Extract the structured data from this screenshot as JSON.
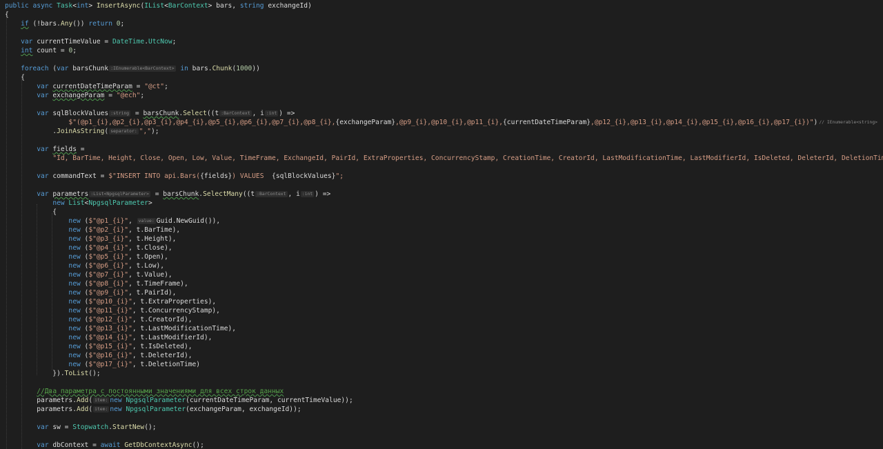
{
  "editor": {
    "t": {
      "public": "public",
      "async": "async",
      "Task": "Task",
      "int": "int",
      "InsertAsync": "InsertAsync",
      "IList": "IList",
      "BarContext": "BarContext",
      "bars": "bars",
      "string": "string",
      "exchangeId": "exchangeId",
      "if": "if",
      "Any": "Any",
      "return": "return",
      "zero": "0",
      "var": "var",
      "currentTimeValue": "currentTimeValue",
      "DateTime": "DateTime",
      "UtcNow": "UtcNow",
      "count": "count",
      "foreach": "foreach",
      "barsChunk": "barsChunk",
      "in": "in",
      "Chunk": "Chunk",
      "thousand": "1000",
      "currentDateTimeParam": "currentDateTimeParam",
      "exchangeParam": "exchangeParam",
      "ctString": "\"@ct\"",
      "echString": "\"@ech\"",
      "sqlBlockValues": "sqlBlockValues",
      "Select": "Select",
      "tParam": "t",
      "iParam": "i",
      "JoinAsString": "JoinAsString",
      "commaString": "\",\"",
      "fields": "fields",
      "commandText": "commandText",
      "parametrs": "parametrs",
      "SelectMany": "SelectMany",
      "new": "new",
      "List": "List",
      "NpgsqlParameter": "NpgsqlParameter",
      "Guid": "Guid",
      "NewGuid": "NewGuid",
      "ToList": "ToList",
      "Add": "Add",
      "sw": "sw",
      "Stopwatch": "Stopwatch",
      "StartNew": "StartNew",
      "dbContext": "dbContext",
      "await": "await",
      "GetDbContextAsync": "GetDbContextAsync",
      "fieldsString": "\"Id, BarTime, Height, Close, Open, Low, Value, TimeFrame, ExchangeId, PairId, ExtraProperties, ConcurrencyStamp, CreationTime, CreatorId, LastModificationTime, LastModifierId, IsDeleted, DeleterId, DeletionTime\";",
      "sqlDollar": "$\"(",
      "sqlPart1": "@p1_{i},@p2_{i},@p3_{i},@p4_{i},@p5_{i},@p6_{i},@p7_{i},@p8_{i},",
      "sqlPart2": "{exchangeParam}",
      "sqlPart3": ",@p9_{i},@p10_{i},@p11_{i},",
      "sqlPart4": "{currentDateTimeParam}",
      "sqlPart5": ",@p12_{i},@p13_{i},@p14_{i},@p15_{i},@p16_{i},@p17_{i})\"",
      "insertPart1": "$\"INSERT INTO api.Bars(",
      "insertPart2": "{fields}",
      "insertPart3": ") VALUES  ",
      "insertPart4": "{sqlBlockValues}",
      "insertPart5": "\";",
      "comment": "//Два параметра с постоянными значениями для всех строк данных"
    },
    "hints": {
      "IEnumerableBarContext": ":IEnumerable<BarContext>",
      "string": ":string",
      "BarContext": ":BarContext",
      "int": ":int",
      "IEnumerableString": "// IEnumerable<string>",
      "separator": "separator:",
      "ListNpgsql": ":List<NpgsqlParameter>",
      "value": "value:",
      "item": "item:"
    },
    "params": [
      {
        "name": "$\"@p1_{i}\"",
        "value": "Guid.NewGuid()),"
      },
      {
        "name": "$\"@p2_{i}\"",
        "value": "t.BarTime),"
      },
      {
        "name": "$\"@p3_{i}\"",
        "value": "t.Height),"
      },
      {
        "name": "$\"@p4_{i}\"",
        "value": "t.Close),"
      },
      {
        "name": "$\"@p5_{i}\"",
        "value": "t.Open),"
      },
      {
        "name": "$\"@p6_{i}\"",
        "value": "t.Low),"
      },
      {
        "name": "$\"@p7_{i}\"",
        "value": "t.Value),"
      },
      {
        "name": "$\"@p8_{i}\"",
        "value": "t.TimeFrame),"
      },
      {
        "name": "$\"@p9_{i}\"",
        "value": "t.PairId),"
      },
      {
        "name": "$\"@p10_{i}\"",
        "value": "t.ExtraProperties),"
      },
      {
        "name": "$\"@p11_{i}\"",
        "value": "t.ConcurrencyStamp),"
      },
      {
        "name": "$\"@p12_{i}\"",
        "value": "t.CreatorId),"
      },
      {
        "name": "$\"@p13_{i}\"",
        "value": "t.LastModificationTime),"
      },
      {
        "name": "$\"@p14_{i}\"",
        "value": "t.LastModifierId),"
      },
      {
        "name": "$\"@p15_{i}\"",
        "value": "t.IsDeleted),"
      },
      {
        "name": "$\"@p16_{i}\"",
        "value": "t.DeleterId),"
      },
      {
        "name": "$\"@p17_{i}\"",
        "value": "t.DeletionTime)"
      }
    ]
  },
  "colors": {
    "background": "#1e1e1e",
    "keyword": "#569cd6",
    "type": "#4ec9b0",
    "method": "#dcdcaa",
    "string": "#d69d85",
    "number": "#b5cea8",
    "comment": "#57a64a",
    "text": "#dcdcdc"
  }
}
